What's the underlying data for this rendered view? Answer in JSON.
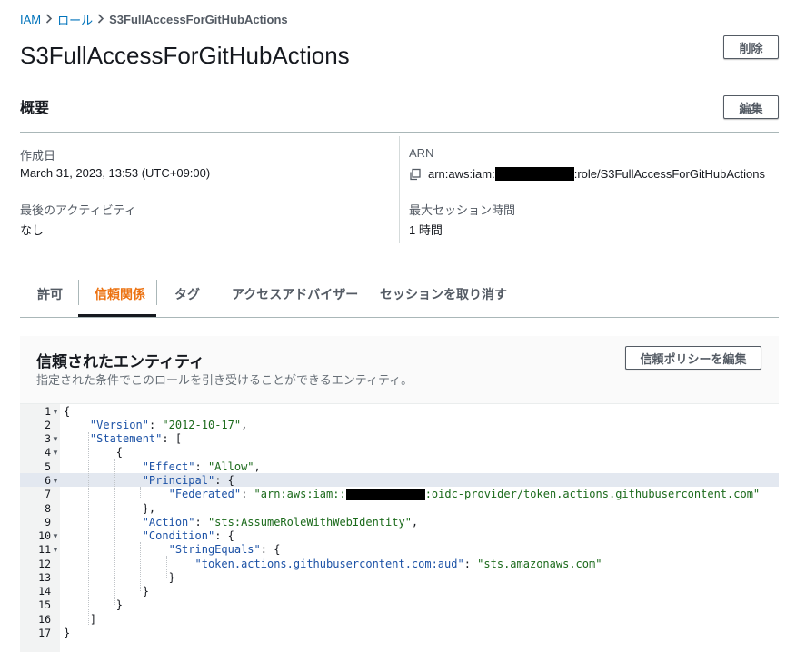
{
  "breadcrumb": {
    "root": "IAM",
    "middle": "ロール",
    "current": "S3FullAccessForGitHubActions",
    "separator": "❯"
  },
  "page_title": "S3FullAccessForGitHubActions",
  "buttons": {
    "delete": "削除",
    "edit": "編集",
    "edit_trust_policy": "信頼ポリシーを編集"
  },
  "summary": {
    "heading": "概要",
    "created_label": "作成日",
    "created_value": "March 31, 2023, 13:53 (UTC+09:00)",
    "last_activity_label": "最後のアクティビティ",
    "last_activity_value": "なし",
    "arn_label": "ARN",
    "arn_prefix": "arn:aws:iam:",
    "arn_suffix": ":role/S3FullAccessForGitHubActions",
    "max_session_label": "最大セッション時間",
    "max_session_value": "1 時間"
  },
  "tabs": [
    "許可",
    "信頼関係",
    "タグ",
    "アクセスアドバイザー",
    "セッションを取り消す"
  ],
  "active_tab": "信頼関係",
  "trusted_entities": {
    "title": "信頼されたエンティティ",
    "subtitle": "指定された条件でこのロールを引き受けることができるエンティティ。"
  },
  "policy": {
    "line_numbers": [
      "1",
      "2",
      "3",
      "4",
      "5",
      "6",
      "7",
      "8",
      "9",
      "10",
      "11",
      "12",
      "13",
      "14",
      "15",
      "16",
      "17"
    ],
    "l1": "{",
    "l2k": "\"Version\"",
    "l2v": "\"2012-10-17\"",
    "l3k": "\"Statement\"",
    "l3v": "[",
    "l4": "{",
    "l5k": "\"Effect\"",
    "l5v": "\"Allow\"",
    "l6k": "\"Principal\"",
    "l6v": "{",
    "l7k": "\"Federated\"",
    "l7v_pre": "\"arn:aws:iam::",
    "l7v_post": ":oidc-provider/token.actions.githubusercontent.com\"",
    "l8": "},",
    "l9k": "\"Action\"",
    "l9v": "\"sts:AssumeRoleWithWebIdentity\"",
    "l10k": "\"Condition\"",
    "l10v": "{",
    "l11k": "\"StringEquals\"",
    "l11v": "{",
    "l12k": "\"token.actions.githubusercontent.com:aud\"",
    "l12v": "\"sts.amazonaws.com\"",
    "l13": "}",
    "l14": "}",
    "l15": "}",
    "l16": "]",
    "l17": "}"
  },
  "colors": {
    "accent": "#ec7211",
    "link": "#0073bb",
    "json_key": "#1c52a6",
    "json_string": "#1b6a1b"
  }
}
